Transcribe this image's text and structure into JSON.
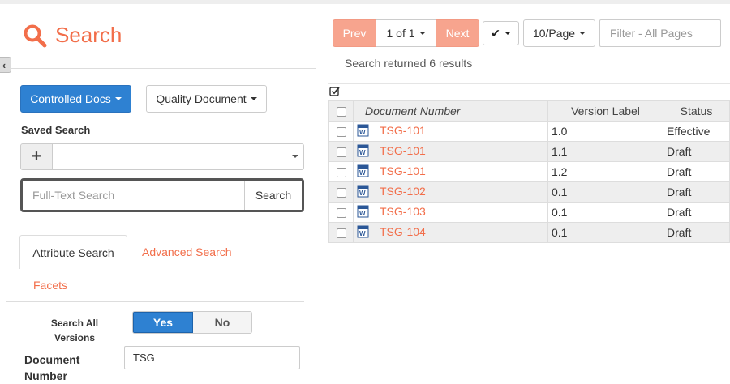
{
  "header": {
    "title": "Search",
    "accent": "#f26e4a"
  },
  "left": {
    "source_dropdown": "Controlled Docs",
    "type_dropdown": "Quality Document",
    "saved_search_label": "Saved Search",
    "saved_search_add": "+",
    "fts_placeholder": "Full-Text Search",
    "fts_button": "Search",
    "tabs": [
      "Attribute Search",
      "Advanced Search",
      "Facets"
    ],
    "search_all_versions_label": "Search All Versions",
    "toggle": {
      "yes": "Yes",
      "no": "No"
    },
    "document_number_label": "Document Number",
    "document_number_value": "TSG"
  },
  "pager": {
    "prev": "Prev",
    "pages": "1 of 1",
    "next": "Next",
    "page_size": "10/Page",
    "filter_placeholder": "Filter - All Pages"
  },
  "results_text": "Search returned 6 results",
  "table": {
    "headers": [
      "Document Number",
      "Version Label",
      "Status"
    ],
    "rows": [
      {
        "doc": "TSG-101",
        "version": "1.0",
        "status": "Effective"
      },
      {
        "doc": "TSG-101",
        "version": "1.1",
        "status": "Draft"
      },
      {
        "doc": "TSG-101",
        "version": "1.2",
        "status": "Draft"
      },
      {
        "doc": "TSG-102",
        "version": "0.1",
        "status": "Draft"
      },
      {
        "doc": "TSG-103",
        "version": "0.1",
        "status": "Draft"
      },
      {
        "doc": "TSG-104",
        "version": "0.1",
        "status": "Draft"
      }
    ]
  },
  "colors": {
    "primary": "#2e81d2",
    "pager_accent": "#f7a48e",
    "link": "#f26e4a"
  },
  "icons": [
    "search-icon",
    "collapse-icon",
    "check-icon",
    "word-doc-icon"
  ]
}
